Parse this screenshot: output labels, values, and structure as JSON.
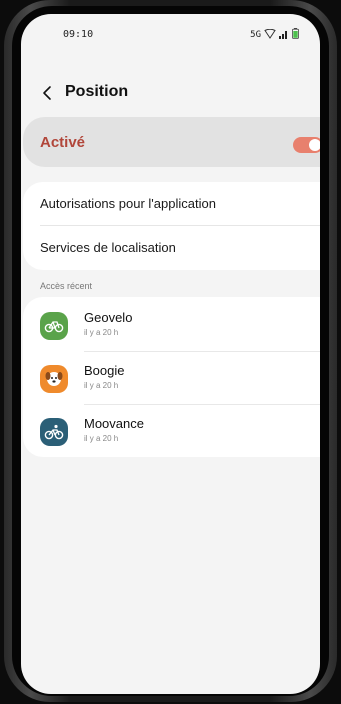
{
  "status_bar": {
    "time": "09:10",
    "network": "5G"
  },
  "header": {
    "title": "Position"
  },
  "master_toggle": {
    "label": "Activé",
    "enabled": true,
    "accent_color": "#e8806d",
    "label_color": "#b1463a"
  },
  "settings": {
    "items": [
      {
        "label": "Autorisations pour l'application"
      },
      {
        "label": "Services de localisation"
      }
    ]
  },
  "recent_access": {
    "title": "Accès récent",
    "apps": [
      {
        "name": "Geovelo",
        "time": "il y a 20 h",
        "icon": "bicycle-icon",
        "color": "#5aa34a"
      },
      {
        "name": "Boogie",
        "time": "il y a 20 h",
        "icon": "dog-icon",
        "color": "#ef8a2c"
      },
      {
        "name": "Moovance",
        "time": "il y a 20 h",
        "icon": "bike-rider-icon",
        "color": "#2b5f77"
      }
    ]
  }
}
